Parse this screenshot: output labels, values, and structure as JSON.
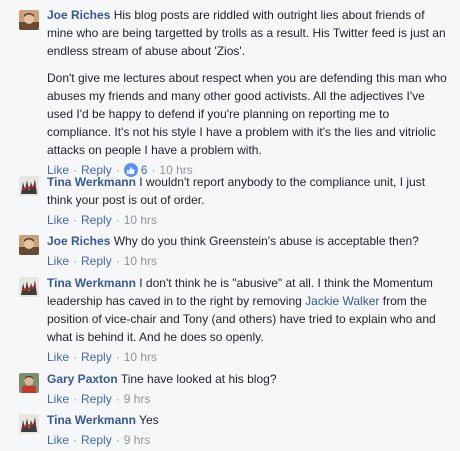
{
  "actions": {
    "like": "Like",
    "reply": "Reply",
    "sep": "·"
  },
  "colors": {
    "link": "#365899",
    "action": "#4267b2",
    "meta": "#90949c",
    "like_badge": "#5890ff",
    "background": "#f6f7f9"
  },
  "comments": [
    {
      "author": "Joe Riches",
      "paragraphs": [
        "His blog posts are riddled with outright lies about friends of mine who are being targetted by trolls as a result. His Twitter feed is just an endless stream of abuse about 'Zios'.",
        "Don't give me lectures about respect when you are defending this man who abuses my friends and many other good activists. All the adjectives I've used I'd be happy to defend if you're planning on reporting me to compliance. It's not his style I have a problem with it's the lies and vitriolic attacks on people I have a problem with."
      ],
      "reactions": "6",
      "reaction_icon": "thumbs-up-icon",
      "time": "10 hrs"
    },
    {
      "author": "Tina Werkmann",
      "text": "I wouldn't report anybody to the compliance unit, I just think your post is out of order.",
      "time": "10 hrs"
    },
    {
      "author": "Joe Riches",
      "text": "Why do you think Greenstein's abuse is acceptable then?",
      "time": "10 hrs"
    },
    {
      "author": "Tina Werkmann",
      "text_before": "I don't think he is \"abusive\" at all. I think the Momentum leadership has caved in to the right by removing",
      "link": "Jackie Walker",
      "text_after": "from the position of vice-chair and Tony (and others) have tried to explain who and what is behind it. And he does so openly.",
      "time": "10 hrs"
    },
    {
      "author": "Gary Paxton",
      "text": "Tine have looked at his blog?",
      "time": "9 hrs"
    },
    {
      "author": "Tina Werkmann",
      "text": "Yes",
      "time": "9 hrs"
    }
  ]
}
